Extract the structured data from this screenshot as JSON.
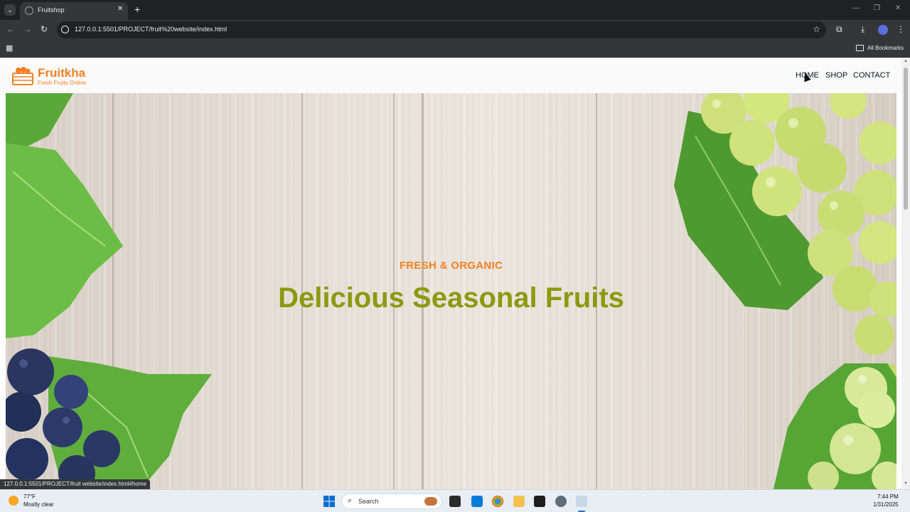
{
  "browser": {
    "tab_title": "Fruitshop",
    "tab_close": "✕",
    "new_tab": "+",
    "address": "127.0.0.1:5501/PROJECT/fruit%20website/index.html",
    "bookmarks_label": "All Bookmarks",
    "status_url": "127.0.0.1:5501/PROJECT/fruit website/index.html#home"
  },
  "site": {
    "logo_name": "Fruitkha",
    "logo_tagline": "Fresh Fruits Online",
    "nav": [
      "HOME",
      "SHOP",
      "CONTACT"
    ],
    "accent_color": "#f28123",
    "title_color": "#8a9a10"
  },
  "hero": {
    "subtitle": "FRESH & ORGANIC",
    "title": "Delicious Seasonal Fruits"
  },
  "taskbar": {
    "weather_temp": "77°F",
    "weather_desc": "Mostly clear",
    "search_placeholder": "Search",
    "time": "7:44 PM",
    "date": "1/31/2025"
  },
  "icons": [
    "tab-list-icon",
    "favicon-icon",
    "back-icon",
    "forward-icon",
    "reload-icon",
    "site-info-icon",
    "bookmark-star-icon",
    "extensions-icon",
    "downloads-icon",
    "menu-icon",
    "apps-icon",
    "folder-icon",
    "crate-logo-icon",
    "windows-start-icon",
    "search-icon"
  ]
}
